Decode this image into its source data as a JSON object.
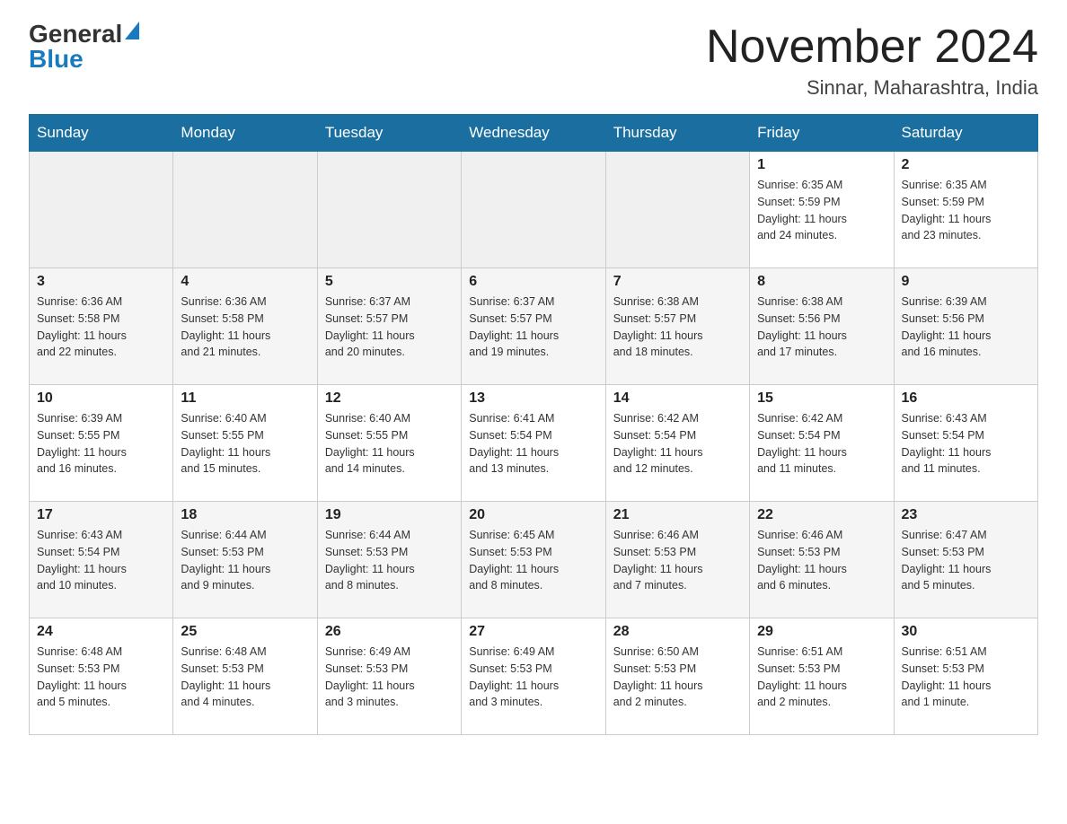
{
  "header": {
    "logo_general": "General",
    "logo_blue": "Blue",
    "month_title": "November 2024",
    "location": "Sinnar, Maharashtra, India"
  },
  "weekdays": [
    "Sunday",
    "Monday",
    "Tuesday",
    "Wednesday",
    "Thursday",
    "Friday",
    "Saturday"
  ],
  "weeks": [
    [
      {
        "day": "",
        "info": ""
      },
      {
        "day": "",
        "info": ""
      },
      {
        "day": "",
        "info": ""
      },
      {
        "day": "",
        "info": ""
      },
      {
        "day": "",
        "info": ""
      },
      {
        "day": "1",
        "info": "Sunrise: 6:35 AM\nSunset: 5:59 PM\nDaylight: 11 hours\nand 24 minutes."
      },
      {
        "day": "2",
        "info": "Sunrise: 6:35 AM\nSunset: 5:59 PM\nDaylight: 11 hours\nand 23 minutes."
      }
    ],
    [
      {
        "day": "3",
        "info": "Sunrise: 6:36 AM\nSunset: 5:58 PM\nDaylight: 11 hours\nand 22 minutes."
      },
      {
        "day": "4",
        "info": "Sunrise: 6:36 AM\nSunset: 5:58 PM\nDaylight: 11 hours\nand 21 minutes."
      },
      {
        "day": "5",
        "info": "Sunrise: 6:37 AM\nSunset: 5:57 PM\nDaylight: 11 hours\nand 20 minutes."
      },
      {
        "day": "6",
        "info": "Sunrise: 6:37 AM\nSunset: 5:57 PM\nDaylight: 11 hours\nand 19 minutes."
      },
      {
        "day": "7",
        "info": "Sunrise: 6:38 AM\nSunset: 5:57 PM\nDaylight: 11 hours\nand 18 minutes."
      },
      {
        "day": "8",
        "info": "Sunrise: 6:38 AM\nSunset: 5:56 PM\nDaylight: 11 hours\nand 17 minutes."
      },
      {
        "day": "9",
        "info": "Sunrise: 6:39 AM\nSunset: 5:56 PM\nDaylight: 11 hours\nand 16 minutes."
      }
    ],
    [
      {
        "day": "10",
        "info": "Sunrise: 6:39 AM\nSunset: 5:55 PM\nDaylight: 11 hours\nand 16 minutes."
      },
      {
        "day": "11",
        "info": "Sunrise: 6:40 AM\nSunset: 5:55 PM\nDaylight: 11 hours\nand 15 minutes."
      },
      {
        "day": "12",
        "info": "Sunrise: 6:40 AM\nSunset: 5:55 PM\nDaylight: 11 hours\nand 14 minutes."
      },
      {
        "day": "13",
        "info": "Sunrise: 6:41 AM\nSunset: 5:54 PM\nDaylight: 11 hours\nand 13 minutes."
      },
      {
        "day": "14",
        "info": "Sunrise: 6:42 AM\nSunset: 5:54 PM\nDaylight: 11 hours\nand 12 minutes."
      },
      {
        "day": "15",
        "info": "Sunrise: 6:42 AM\nSunset: 5:54 PM\nDaylight: 11 hours\nand 11 minutes."
      },
      {
        "day": "16",
        "info": "Sunrise: 6:43 AM\nSunset: 5:54 PM\nDaylight: 11 hours\nand 11 minutes."
      }
    ],
    [
      {
        "day": "17",
        "info": "Sunrise: 6:43 AM\nSunset: 5:54 PM\nDaylight: 11 hours\nand 10 minutes."
      },
      {
        "day": "18",
        "info": "Sunrise: 6:44 AM\nSunset: 5:53 PM\nDaylight: 11 hours\nand 9 minutes."
      },
      {
        "day": "19",
        "info": "Sunrise: 6:44 AM\nSunset: 5:53 PM\nDaylight: 11 hours\nand 8 minutes."
      },
      {
        "day": "20",
        "info": "Sunrise: 6:45 AM\nSunset: 5:53 PM\nDaylight: 11 hours\nand 8 minutes."
      },
      {
        "day": "21",
        "info": "Sunrise: 6:46 AM\nSunset: 5:53 PM\nDaylight: 11 hours\nand 7 minutes."
      },
      {
        "day": "22",
        "info": "Sunrise: 6:46 AM\nSunset: 5:53 PM\nDaylight: 11 hours\nand 6 minutes."
      },
      {
        "day": "23",
        "info": "Sunrise: 6:47 AM\nSunset: 5:53 PM\nDaylight: 11 hours\nand 5 minutes."
      }
    ],
    [
      {
        "day": "24",
        "info": "Sunrise: 6:48 AM\nSunset: 5:53 PM\nDaylight: 11 hours\nand 5 minutes."
      },
      {
        "day": "25",
        "info": "Sunrise: 6:48 AM\nSunset: 5:53 PM\nDaylight: 11 hours\nand 4 minutes."
      },
      {
        "day": "26",
        "info": "Sunrise: 6:49 AM\nSunset: 5:53 PM\nDaylight: 11 hours\nand 3 minutes."
      },
      {
        "day": "27",
        "info": "Sunrise: 6:49 AM\nSunset: 5:53 PM\nDaylight: 11 hours\nand 3 minutes."
      },
      {
        "day": "28",
        "info": "Sunrise: 6:50 AM\nSunset: 5:53 PM\nDaylight: 11 hours\nand 2 minutes."
      },
      {
        "day": "29",
        "info": "Sunrise: 6:51 AM\nSunset: 5:53 PM\nDaylight: 11 hours\nand 2 minutes."
      },
      {
        "day": "30",
        "info": "Sunrise: 6:51 AM\nSunset: 5:53 PM\nDaylight: 11 hours\nand 1 minute."
      }
    ]
  ]
}
